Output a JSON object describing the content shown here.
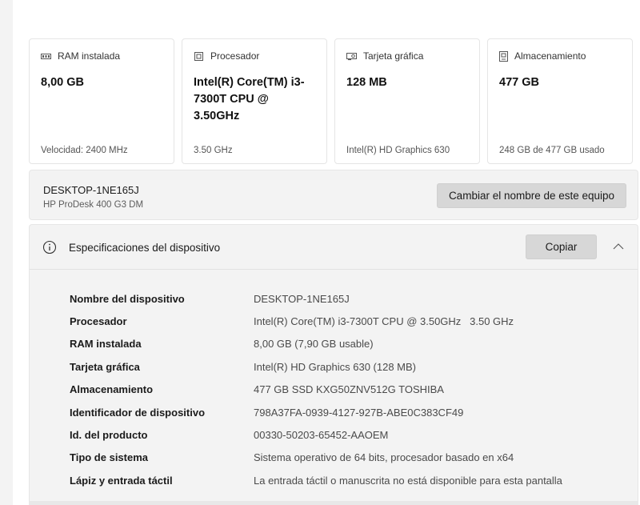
{
  "cards": [
    {
      "icon": "ram-icon",
      "title": "RAM instalada",
      "value": "8,00 GB",
      "footer": "Velocidad: 2400 MHz"
    },
    {
      "icon": "processor-icon",
      "title": "Procesador",
      "value": "Intel(R) Core(TM) i3-7300T CPU @ 3.50GHz",
      "footer": "3.50 GHz"
    },
    {
      "icon": "graphics-card-icon",
      "title": "Tarjeta gráfica",
      "value": "128 MB",
      "footer": "Intel(R) HD Graphics 630"
    },
    {
      "icon": "storage-icon",
      "title": "Almacenamiento",
      "value": "477 GB",
      "footer": "248 GB de 477 GB usado"
    }
  ],
  "device": {
    "name": "DESKTOP-1NE165J",
    "model": "HP ProDesk 400 G3 DM",
    "rename_label": "Cambiar el nombre de este equipo"
  },
  "specs": {
    "title": "Especificaciones del dispositivo",
    "copy_label": "Copiar",
    "rows": [
      {
        "label": "Nombre del dispositivo",
        "value": "DESKTOP-1NE165J"
      },
      {
        "label": "Procesador",
        "value": "Intel(R) Core(TM) i3-7300T CPU @ 3.50GHz   3.50 GHz"
      },
      {
        "label": "RAM instalada",
        "value": "8,00 GB (7,90 GB usable)"
      },
      {
        "label": "Tarjeta gráfica",
        "value": "Intel(R) HD Graphics 630 (128 MB)"
      },
      {
        "label": "Almacenamiento",
        "value": "477 GB SSD KXG50ZNV512G TOSHIBA"
      },
      {
        "label": "Identificador de dispositivo",
        "value": "798A37FA-0939-4127-927B-ABE0C383CF49"
      },
      {
        "label": "Id. del producto",
        "value": "00330-50203-65452-AAOEM"
      },
      {
        "label": "Tipo de sistema",
        "value": "Sistema operativo de 64 bits, procesador basado en x64"
      },
      {
        "label": "Lápiz y entrada táctil",
        "value": "La entrada táctil o manuscrita no está disponible para esta pantalla"
      }
    ]
  }
}
